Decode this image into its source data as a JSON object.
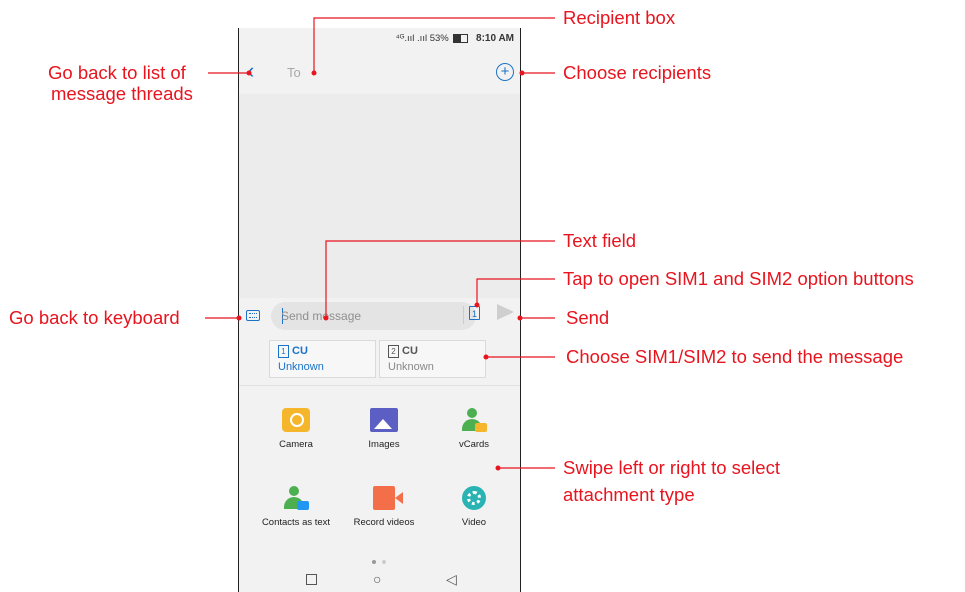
{
  "status_bar": {
    "signal": "⁴ᴳ.ııl .ııl",
    "battery": "53%",
    "time": "8:10 AM"
  },
  "header": {
    "back_icon": "chevron-left-icon",
    "to_placeholder": "To",
    "add_icon": "plus-circle-icon"
  },
  "composer": {
    "placeholder": "Send message",
    "sim_indicator": "1",
    "send_icon": "send-icon"
  },
  "sim_options": [
    {
      "num": "1",
      "carrier": "CU",
      "status": "Unknown"
    },
    {
      "num": "2",
      "carrier": "CU",
      "status": "Unknown"
    }
  ],
  "attachments": [
    {
      "label": "Camera",
      "icon": "camera-icon"
    },
    {
      "label": "Images",
      "icon": "images-icon"
    },
    {
      "label": "vCards",
      "icon": "vcard-icon"
    },
    {
      "label": "Contacts as text",
      "icon": "contacts-text-icon"
    },
    {
      "label": "Record videos",
      "icon": "record-video-icon"
    },
    {
      "label": "Video",
      "icon": "video-icon"
    }
  ],
  "nav": {
    "recent": "□",
    "home": "○",
    "back": "◁"
  },
  "annotations": {
    "recipient_box": "Recipient box",
    "go_back_list_1": "Go back to list of",
    "go_back_list_2": "message threads",
    "choose_recipients": "Choose recipients",
    "text_field": "Text field",
    "sim_option": "Tap to open SIM1 and SIM2 option buttons",
    "go_back_keyboard": "Go back to keyboard",
    "send": "Send",
    "choose_sim": "Choose SIM1/SIM2 to send the message",
    "swipe_1": "Swipe left or right to select",
    "swipe_2": "attachment type"
  },
  "colors": {
    "accent": "#1a73c8",
    "annotation": "#e8141e"
  }
}
